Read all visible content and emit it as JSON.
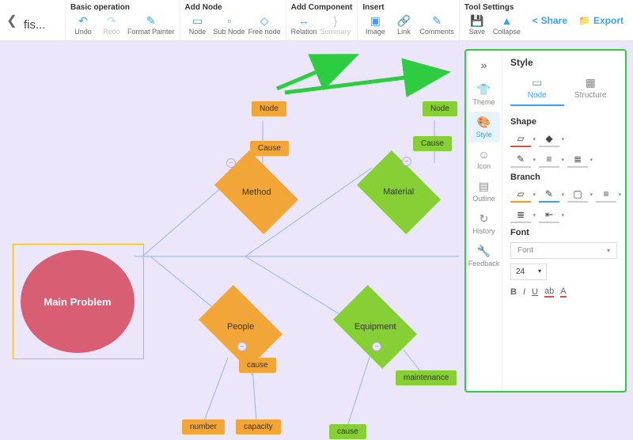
{
  "filename": "fis...",
  "toolbar": {
    "groups": {
      "basic": {
        "label": "Basic operation",
        "undo": "Undo",
        "redo": "Redo",
        "format": "Format Painter"
      },
      "addnode": {
        "label": "Add Node",
        "node": "Node",
        "sub": "Sub Node",
        "free": "Free node"
      },
      "addcomp": {
        "label": "Add Component",
        "relation": "Relation",
        "summary": "Summary"
      },
      "insert": {
        "label": "Insert",
        "image": "Image",
        "link": "Link",
        "comments": "Comments"
      },
      "tool": {
        "label": "Tool Settings",
        "save": "Save",
        "collapse": "Collapse"
      }
    },
    "share": "Share",
    "export": "Export"
  },
  "sidetabs": {
    "theme": "Theme",
    "style": "Style",
    "icon": "Icon",
    "outline": "Outline",
    "history": "History",
    "feedback": "Feedback"
  },
  "panel": {
    "title": "Style",
    "tabs": {
      "node": "Node",
      "structure": "Structure"
    },
    "sections": {
      "shape": "Shape",
      "branch": "Branch",
      "font": "Font"
    },
    "font_select": "Font",
    "font_size": "24",
    "fmt": {
      "b": "B",
      "i": "I",
      "u": "U",
      "ab": "ab",
      "a": "A"
    }
  },
  "nodes": {
    "main": "Main Problem",
    "method": "Method",
    "material": "Material",
    "people": "People",
    "equipment": "Equipment",
    "node": "Node",
    "cause": "Cause",
    "cause_l": "cause",
    "number": "number",
    "capacity": "capacity",
    "maintenance": "maintenance"
  }
}
